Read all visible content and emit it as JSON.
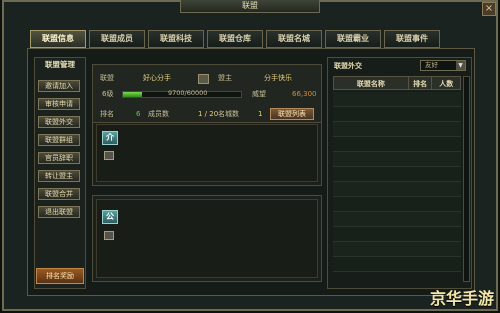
{
  "window": {
    "title": "联盟",
    "close_glyph": "×"
  },
  "tabs": [
    "联盟信息",
    "联盟成员",
    "联盟科技",
    "联盟仓库",
    "联盟名城",
    "联盟霸业",
    "联盟事件"
  ],
  "sidebar": {
    "title": "联盟管理",
    "items": [
      "邀请加入",
      "审核申请",
      "联盟外交",
      "联盟群组",
      "官员辞职",
      "转让盟主",
      "联盟合并",
      "退出联盟"
    ],
    "reward_button": "排名奖励"
  },
  "info": {
    "alliance_label": "联盟",
    "alliance_name": "好心分手",
    "leader_label": "盟主",
    "leader_name": "分手快乐",
    "level_label": "6级",
    "exp_text": "9700/60000",
    "exp_progress": 0.1617,
    "prestige_label": "威望",
    "prestige_value": "66,300",
    "rank_label": "排名",
    "rank_value": "6",
    "members_label": "成员数",
    "members_value": "1 / 20",
    "cities_label": "名城数",
    "cities_value": "1",
    "list_button": "联盟列表",
    "intro_icon": "介",
    "notice_icon": "公"
  },
  "diplomacy": {
    "title": "联盟外交",
    "filter": "友好",
    "columns": [
      "联盟名称",
      "排名",
      "人数"
    ]
  },
  "watermark": "京华手游"
}
